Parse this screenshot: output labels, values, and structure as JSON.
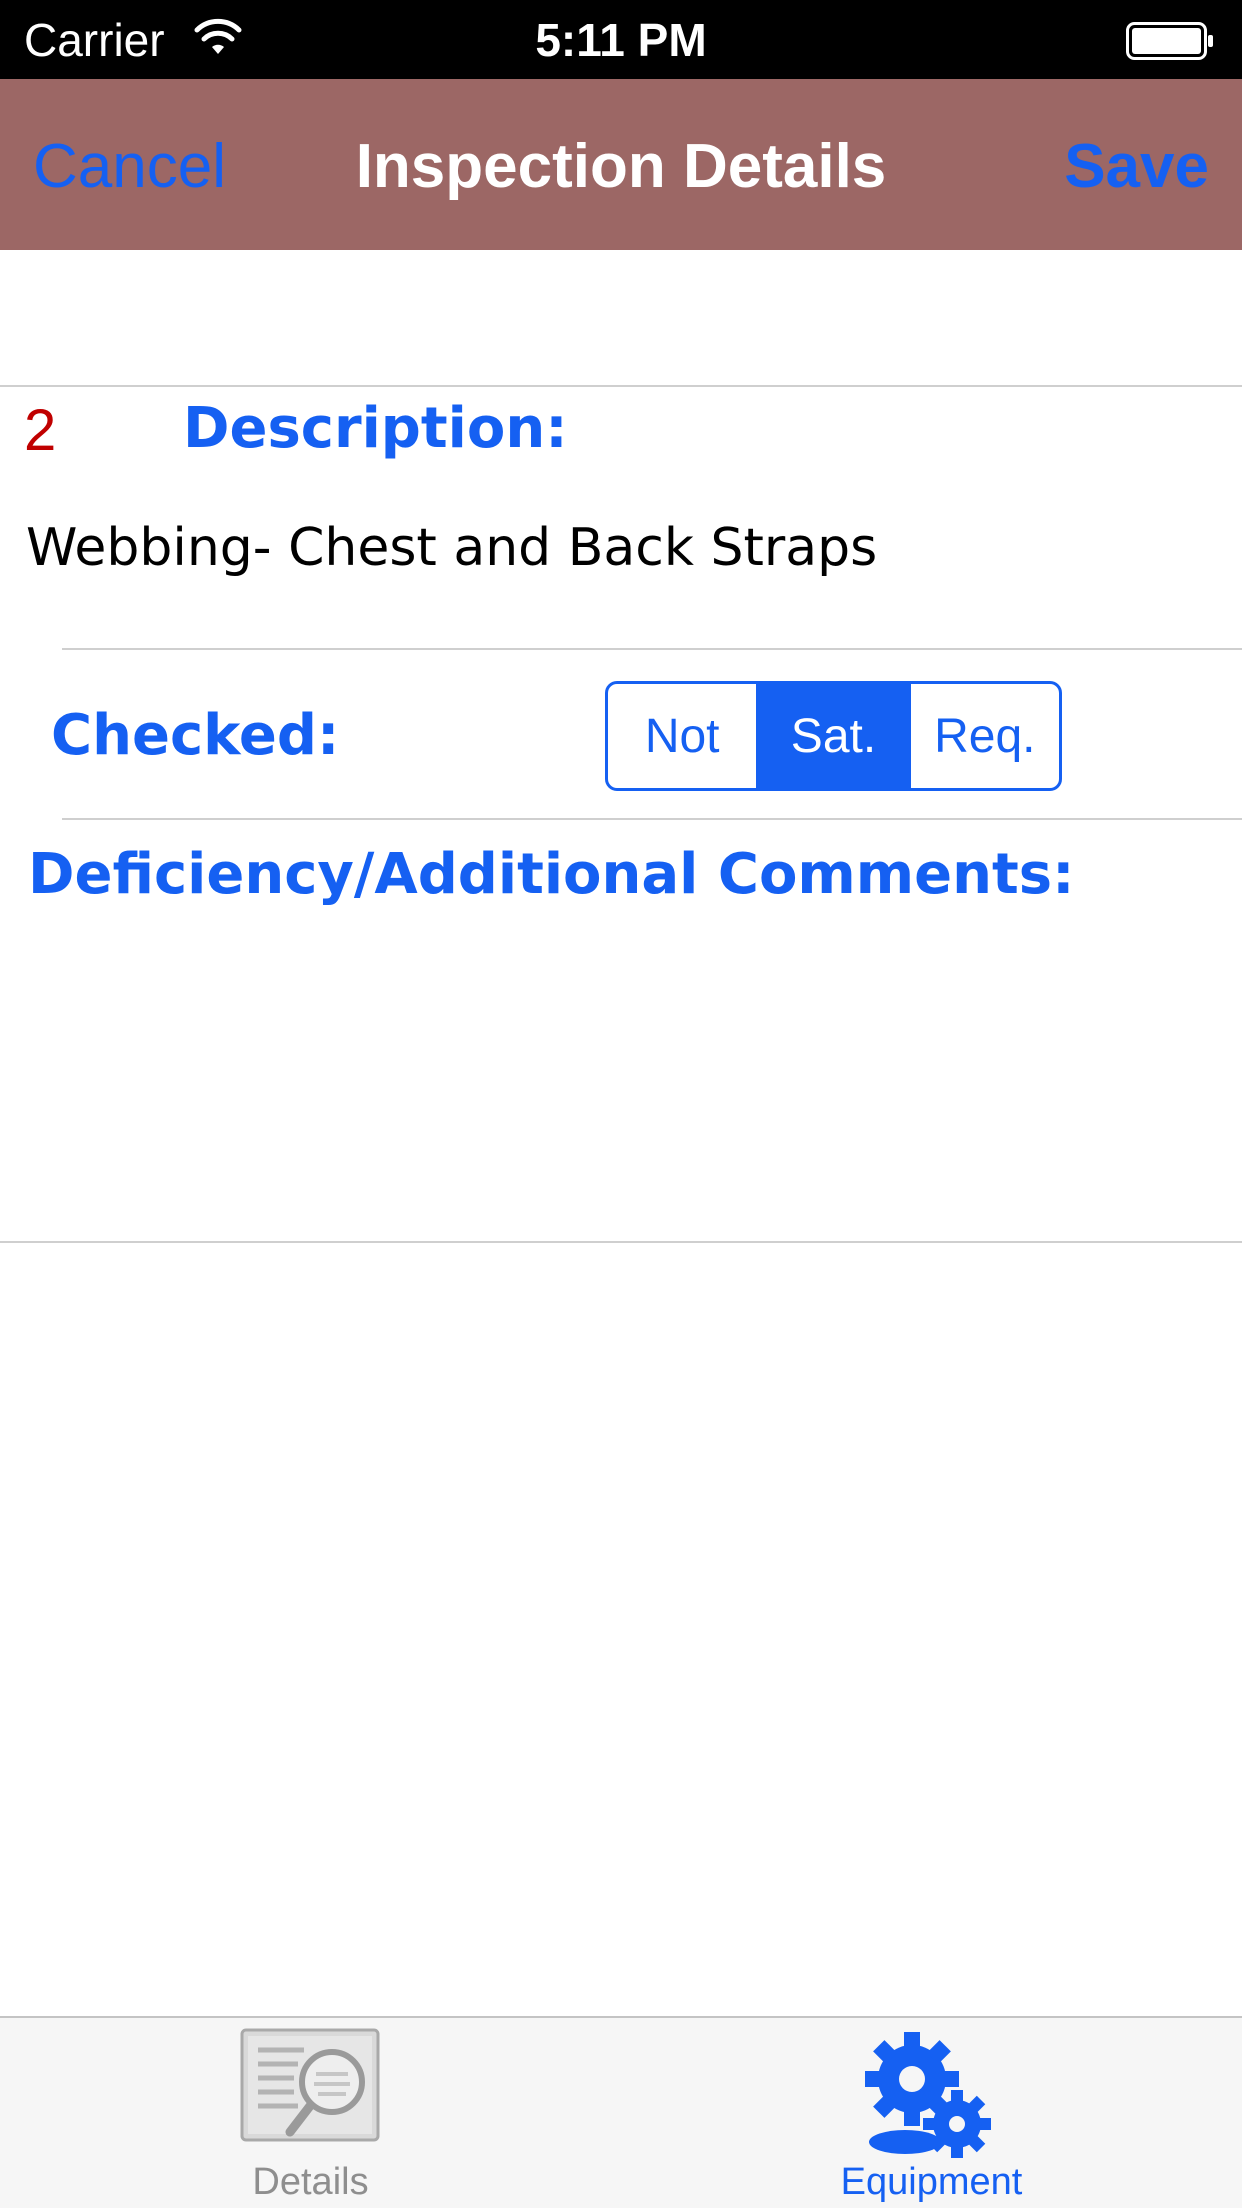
{
  "status_bar": {
    "carrier": "Carrier",
    "time": "5:11 PM"
  },
  "nav": {
    "cancel_label": "Cancel",
    "title": "Inspection Details",
    "save_label": "Save"
  },
  "item": {
    "number": "2",
    "description_label": "Description:",
    "description_value": "Webbing- Chest and Back Straps",
    "checked_label": "Checked:",
    "checked_options": [
      "Not",
      "Sat.",
      "Req."
    ],
    "checked_selected": "Sat.",
    "comments_label": "Deficiency/Additional Comments:",
    "comments_value": ""
  },
  "tab_bar": {
    "tabs": [
      {
        "label": "Details",
        "icon": "magnifier-document-icon",
        "selected": false
      },
      {
        "label": "Equipment",
        "icon": "gears-icon",
        "selected": true
      }
    ]
  },
  "colors": {
    "nav_background": "#9c6765",
    "accent_blue": "#1560f2",
    "number_red": "#c00000",
    "tab_bar_background": "#f6f6f6"
  }
}
